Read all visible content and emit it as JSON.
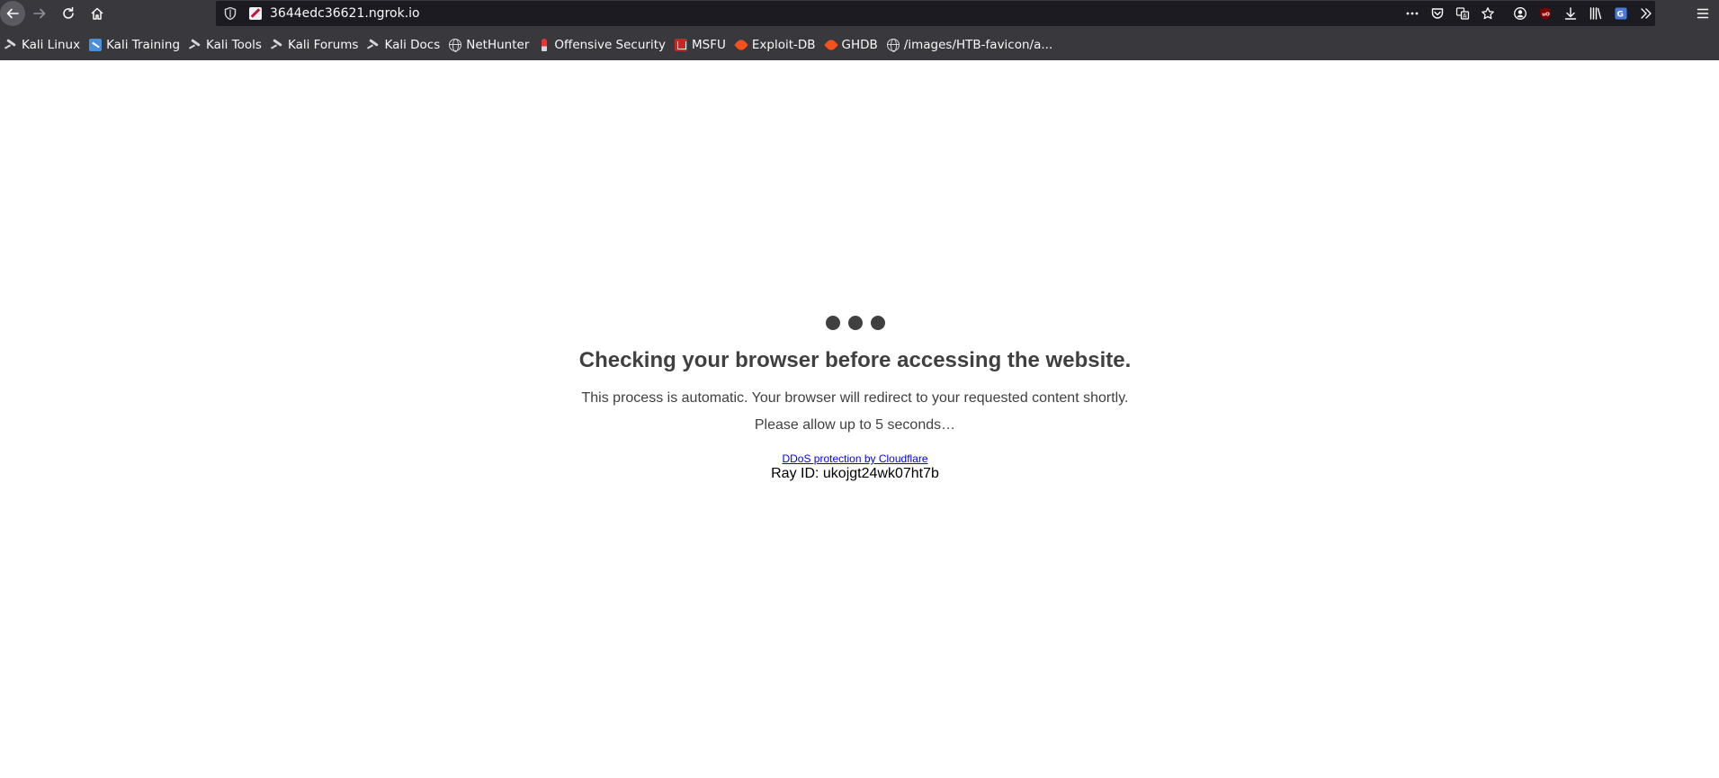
{
  "browser": {
    "url": "3644edc36621.ngrok.io",
    "toolbar": {
      "back": "back-arrow-icon",
      "forward": "forward-arrow-icon",
      "reload": "reload-icon",
      "home": "home-icon"
    },
    "bookmarks": [
      {
        "label": "Kali Linux",
        "icon": "kali-dragon-icon"
      },
      {
        "label": "Kali Training",
        "icon": "kali-training-icon"
      },
      {
        "label": "Kali Tools",
        "icon": "kali-dragon-icon"
      },
      {
        "label": "Kali Forums",
        "icon": "kali-dragon-icon"
      },
      {
        "label": "Kali Docs",
        "icon": "kali-dragon-icon"
      },
      {
        "label": "NetHunter",
        "icon": "globe-icon"
      },
      {
        "label": "Offensive Security",
        "icon": "offsec-icon"
      },
      {
        "label": "MSFU",
        "icon": "msfu-icon"
      },
      {
        "label": "Exploit-DB",
        "icon": "exploit-db-icon"
      },
      {
        "label": "GHDB",
        "icon": "exploit-db-icon"
      },
      {
        "label": "/images/HTB-favicon/a...",
        "icon": "globe-icon"
      }
    ]
  },
  "page": {
    "heading": "Checking your browser before accessing the website.",
    "line1": "This process is automatic. Your browser will redirect to your requested content shortly.",
    "line2": "Please allow up to 5 seconds…",
    "cloudflare_link": "DDoS protection by Cloudflare",
    "ray_id": "Ray ID: ukojgt24wk07ht7b"
  }
}
